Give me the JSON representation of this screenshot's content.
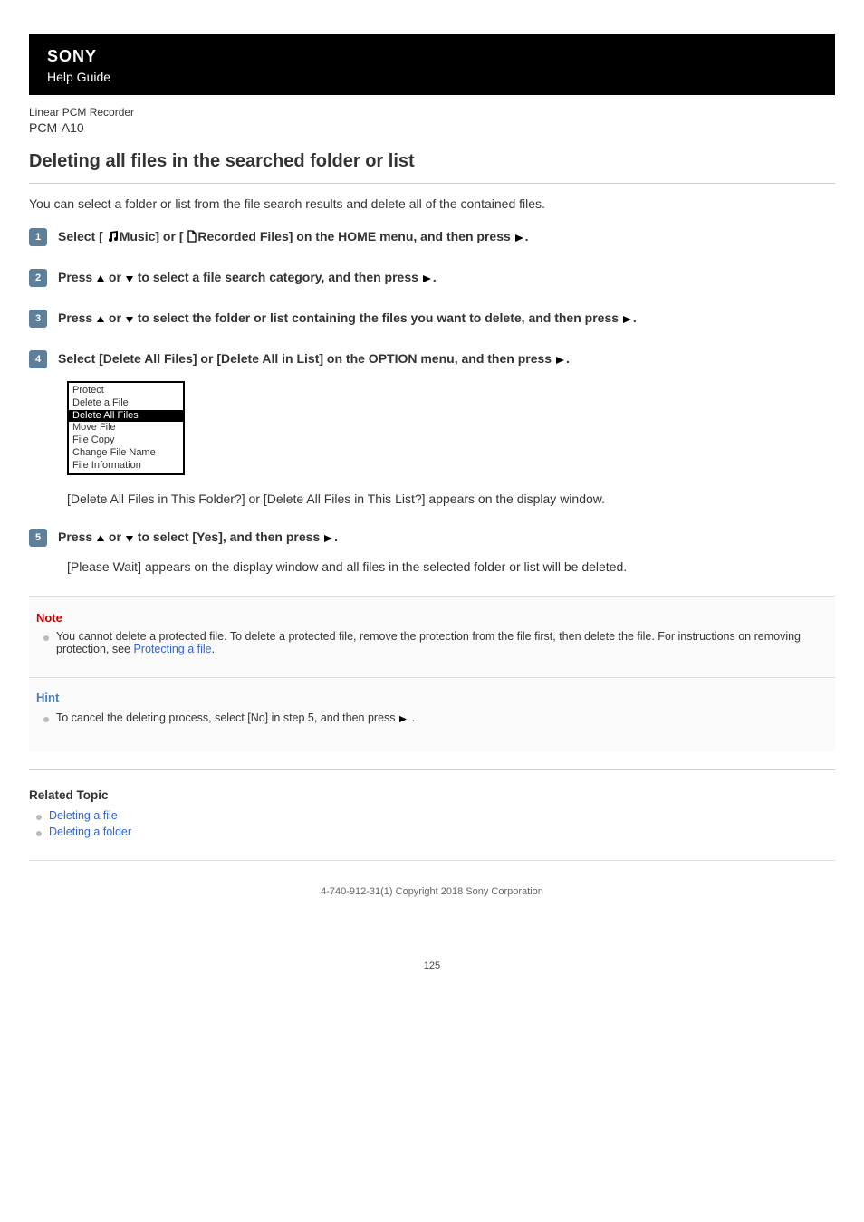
{
  "header": {
    "brand": "SONY",
    "subtitle": "Help Guide",
    "product_type": "Linear PCM Recorder",
    "product_model": "PCM-A10"
  },
  "title": "Deleting all files in the searched folder or list",
  "intro": "You can select a folder or list from the file search results and delete all of the contained files.",
  "steps": [
    {
      "num": "1",
      "prefix": "Select [ ",
      "mid1": "Music] or [ ",
      "mid2": "Recorded Files] on the HOME menu, and then press ",
      "suffix": "."
    },
    {
      "num": "2",
      "prefix": "Press ",
      "mid": " to select a file search category, and then press",
      "suffix": "."
    },
    {
      "num": "3",
      "prefix": "Press ",
      "mid": " to select the folder or list containing the files you want to delete, and then press",
      "suffix": "."
    },
    {
      "num": "4",
      "prefix": "Select [Delete All Files] or [Delete All in List] on the OPTION menu, and then press",
      "suffix": ".",
      "screenshot_items": [
        "Protect",
        "Delete a File",
        "Delete All Files",
        "Move File",
        "File Copy",
        "Change File Name",
        "File Information"
      ],
      "screenshot_selected_index": 2,
      "result": "[Delete All Files in This Folder?] or [Delete All Files in This List?] appears on the display window."
    },
    {
      "num": "5",
      "prefix": "Press ",
      "mid": " to select [Yes], and then press ",
      "suffix": ".",
      "result": "[Please Wait] appears on the display window and all files in the selected folder or list will be deleted."
    }
  ],
  "note": {
    "title": "Note",
    "text_before": "You cannot delete a protected file. To delete a protected file, remove the protection from the file first, then delete the file. For instructions on removing protection, see ",
    "link_text": "Protecting a file",
    "text_after": "."
  },
  "hint": {
    "title": "Hint",
    "text_before": "To cancel the deleting process, select [No] in step 5, and then press",
    "text_after": "."
  },
  "related": {
    "title": "Related Topic",
    "links": [
      "Deleting a file",
      "Deleting a folder"
    ]
  },
  "footer": "4-740-912-31(1) Copyright 2018 Sony Corporation",
  "page_number": "125",
  "glyphs": {
    "or": " or "
  }
}
